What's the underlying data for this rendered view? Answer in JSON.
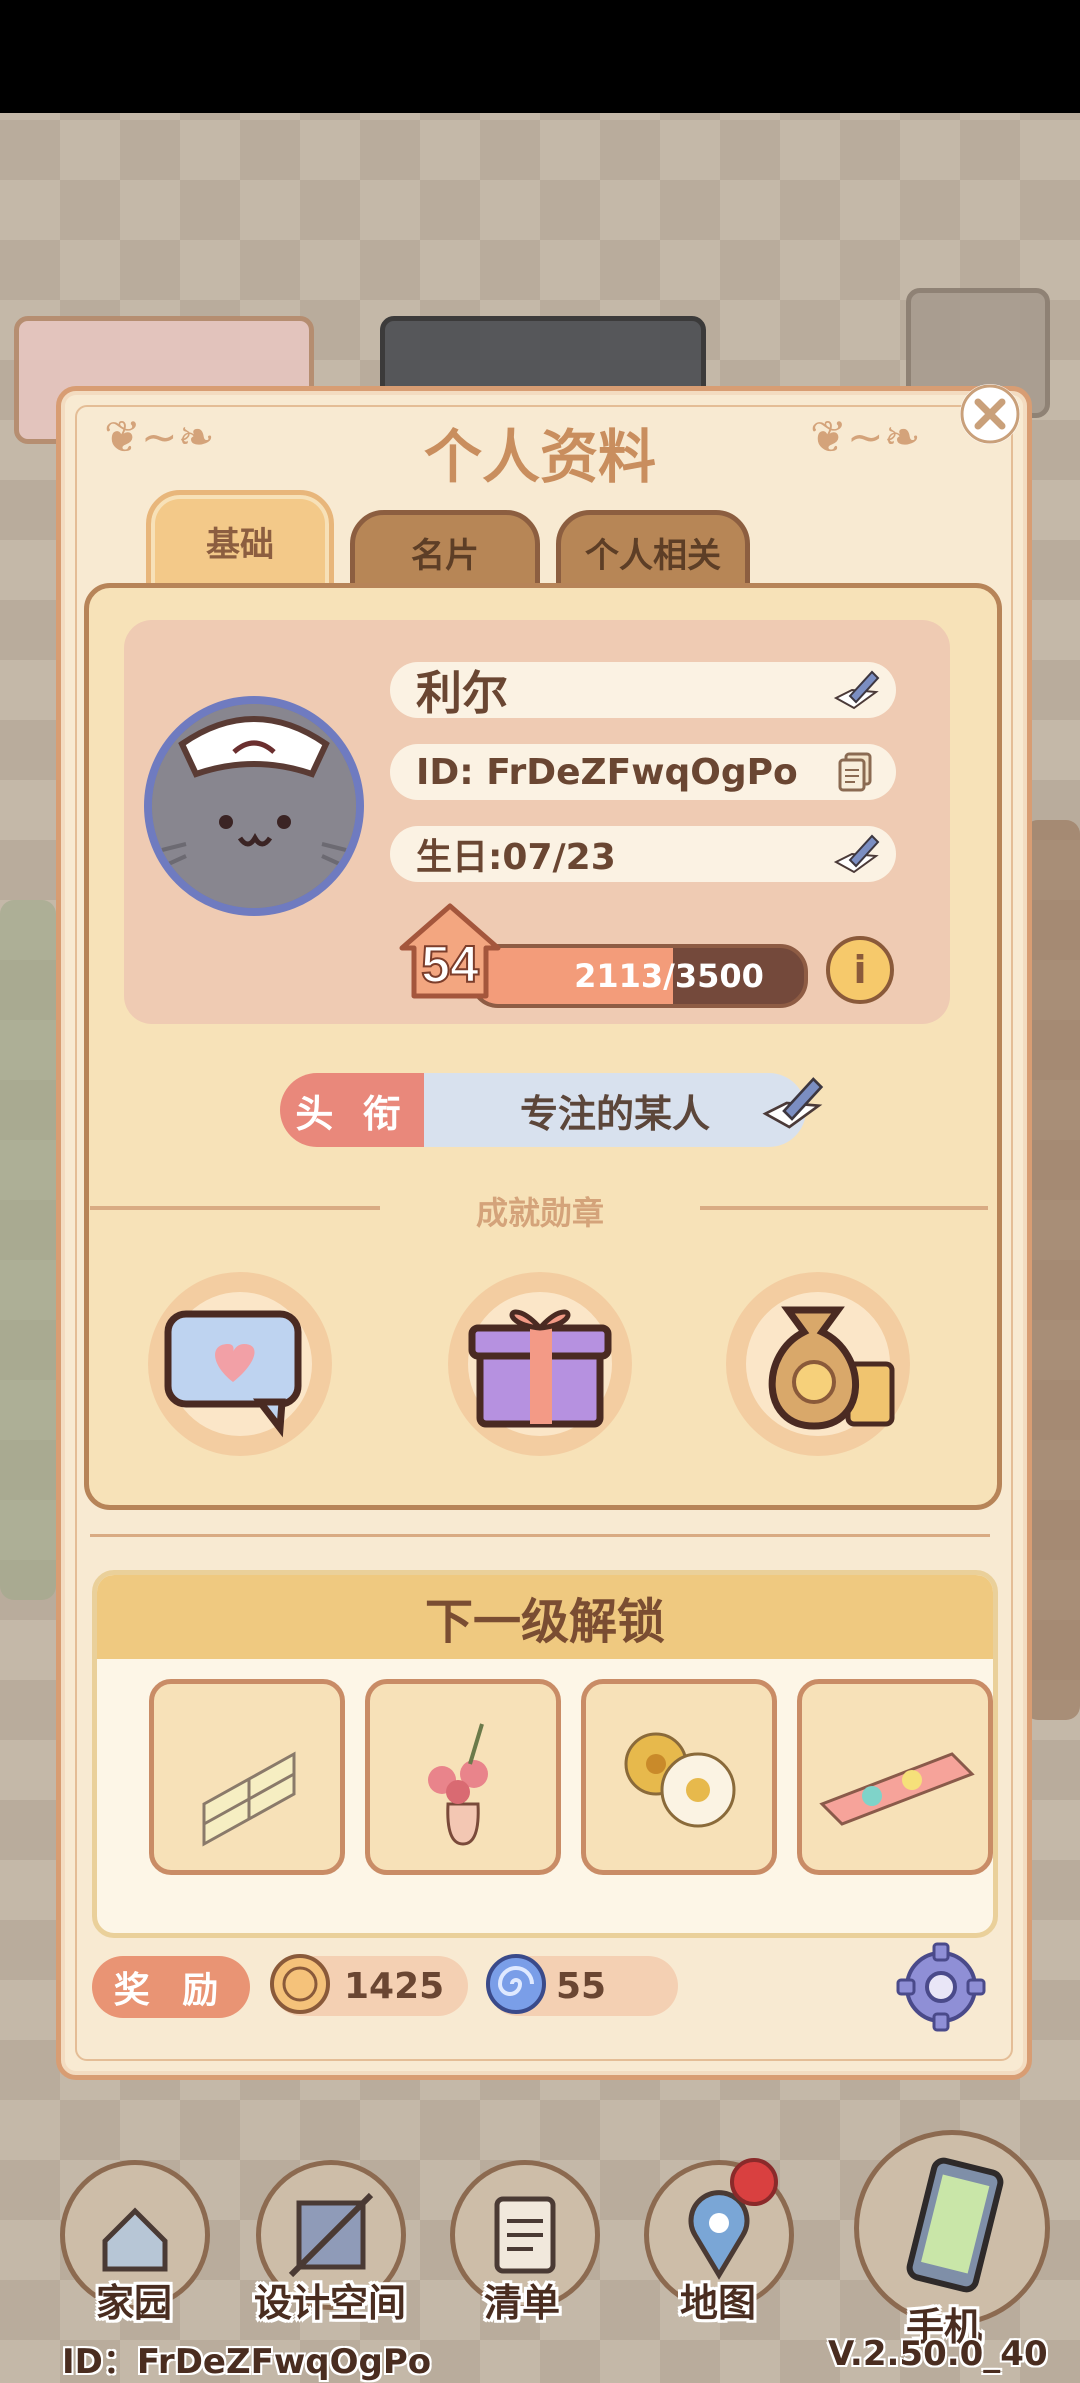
{
  "dialog": {
    "title": "个人资料",
    "tabs": [
      {
        "label": "基础",
        "active": true
      },
      {
        "label": "名片",
        "active": false
      },
      {
        "label": "个人相关",
        "active": false
      }
    ]
  },
  "profile": {
    "name": "利尔",
    "id_text": "ID: FrDeZFwqOgPo",
    "birthday_text": "生日:07/23",
    "level": "54",
    "xp_text": "2113/3500",
    "xp_fraction": 0.6037
  },
  "title_tag": {
    "label": "头 衔",
    "value": "专注的某人"
  },
  "achievements": {
    "label": "成就勋章",
    "medals": [
      "chat-heart-medal",
      "gift-box-medal",
      "money-bag-medal"
    ]
  },
  "unlock": {
    "heading": "下一级解锁",
    "items": [
      "window-item",
      "flower-vase-item",
      "flower-rug-item",
      "floral-panel-item"
    ]
  },
  "rewards": {
    "label": "奖 励",
    "coin_amount": "1425",
    "gem_amount": "55"
  },
  "nav": {
    "items": [
      {
        "label": "家园",
        "icon": "house-icon"
      },
      {
        "label": "设计空间",
        "icon": "ruler-icon"
      },
      {
        "label": "清单",
        "icon": "list-icon"
      },
      {
        "label": "地图",
        "icon": "map-pin-icon"
      },
      {
        "label": "手机",
        "icon": "phone-icon"
      }
    ]
  },
  "footer": {
    "id_text": "ID：FrDeZFwqOgPo",
    "version": "V.2.50.0_40"
  },
  "colors": {
    "panel": "#f7e2b8",
    "accent": "#e9887b",
    "title": "#c98e5e"
  }
}
